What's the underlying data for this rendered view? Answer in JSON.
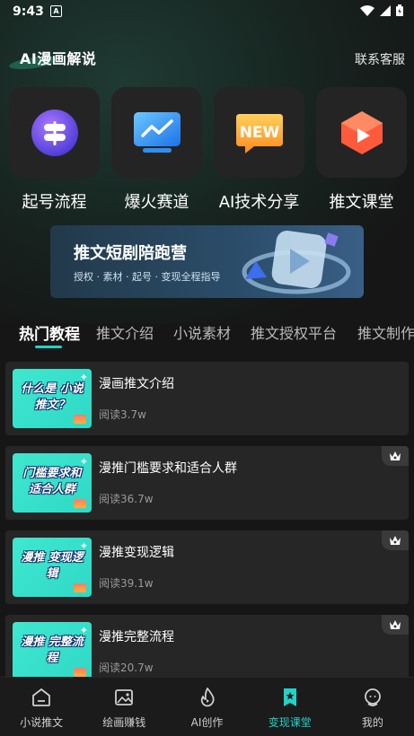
{
  "status": {
    "time": "9:43"
  },
  "header": {
    "brand": "AI漫画解说",
    "service": "联系客服"
  },
  "quick_items": [
    {
      "label": "起号流程",
      "icon": "signpost-icon"
    },
    {
      "label": "爆火赛道",
      "icon": "trend-monitor-icon"
    },
    {
      "label": "AI技术分享",
      "icon": "new-badge-icon"
    },
    {
      "label": "推文课堂",
      "icon": "play-cube-icon"
    }
  ],
  "banner": {
    "title": "推文短剧陪跑营",
    "subtitle": "授权 · 素材 · 起号 · 变现全程指导"
  },
  "tabs": [
    "热门教程",
    "推文介绍",
    "小说素材",
    "推文授权平台",
    "推文制作"
  ],
  "courses": [
    {
      "thumb_text": "什么是 小说推文？",
      "title": "漫画推文介绍",
      "reads": "阅读3.7w",
      "premium": false
    },
    {
      "thumb_text": "门槛要求和 适合人群",
      "title": "漫推门槛要求和适合人群",
      "reads": "阅读36.7w",
      "premium": true
    },
    {
      "thumb_text": "漫推 变现逻辑",
      "title": "漫推变现逻辑",
      "reads": "阅读39.1w",
      "premium": true
    },
    {
      "thumb_text": "漫推 完整流程",
      "title": "漫推完整流程",
      "reads": "阅读20.7w",
      "premium": true
    }
  ],
  "nav": [
    {
      "label": "小说推文",
      "icon": "home-icon"
    },
    {
      "label": "绘画赚钱",
      "icon": "image-icon"
    },
    {
      "label": "AI创作",
      "icon": "flame-icon"
    },
    {
      "label": "变现课堂",
      "icon": "bookmark-star-icon",
      "active": true
    },
    {
      "label": "我的",
      "icon": "profile-icon"
    }
  ],
  "colors": {
    "accent": "#22d3c5",
    "background": "#161616",
    "card": "#262626"
  }
}
